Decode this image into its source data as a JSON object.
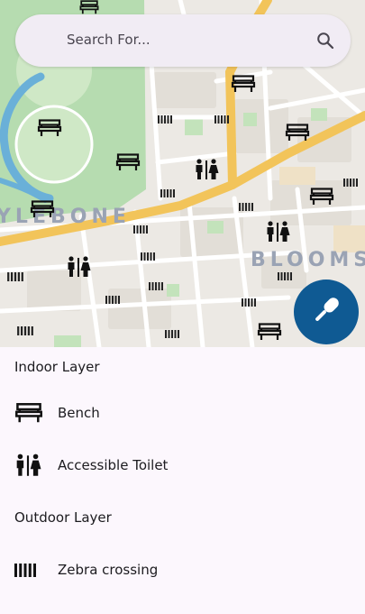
{
  "search": {
    "placeholder": "Search For..."
  },
  "map": {
    "labels": {
      "left_area": "YLEBONE",
      "right_area": "BLOOMS"
    }
  },
  "mic_button": {
    "icon": "microphone-icon"
  },
  "legend": {
    "indoor_title": "Indoor Layer",
    "indoor_items": [
      {
        "icon": "bench-icon",
        "label": "Bench"
      },
      {
        "icon": "accessible-toilet-icon",
        "label": "Accessible Toilet"
      }
    ],
    "outdoor_title": "Outdoor Layer",
    "outdoor_items": [
      {
        "icon": "zebra-crossing-icon",
        "label": "Zebra crossing"
      }
    ]
  },
  "colors": {
    "fab": "#0f5a93",
    "park": "#b6dcb0",
    "water": "#6ab0d8",
    "major_road": "#f2c45a",
    "search_bar": "#f1ecf4",
    "panel_bg": "#fcf7fd"
  }
}
